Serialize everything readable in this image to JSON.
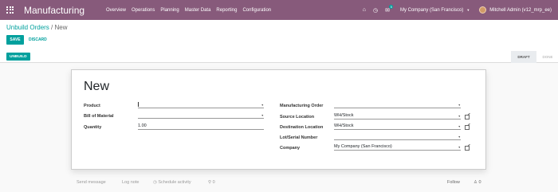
{
  "navbar": {
    "app_title": "Manufacturing",
    "menu": [
      "Overview",
      "Operations",
      "Planning",
      "Master Data",
      "Reporting",
      "Configuration"
    ],
    "chat_count": "5",
    "company": "My Company (San Francisco)",
    "user": "Mitchell Admin (v12_mrp_ee)"
  },
  "breadcrumb": {
    "parent": "Unbuild Orders",
    "sep": "/",
    "current": "New"
  },
  "buttons": {
    "save": "SAVE",
    "discard": "DISCARD",
    "unbuild": "UNBUILD"
  },
  "status": {
    "draft": "DRAFT",
    "done": "DONE",
    "active": "draft"
  },
  "form": {
    "title": "New",
    "left": [
      {
        "label": "Product",
        "value": ""
      },
      {
        "label": "Bill of Material",
        "value": ""
      },
      {
        "label": "Quantity",
        "value": "1.00"
      }
    ],
    "right": [
      {
        "label": "Manufacturing Order",
        "value": ""
      },
      {
        "label": "Source Location",
        "value": "WH/Stock"
      },
      {
        "label": "Destination Location",
        "value": "WH/Stock"
      },
      {
        "label": "Lot/Serial Number",
        "value": ""
      },
      {
        "label": "Company",
        "value": "My Company (San Francisco)"
      }
    ]
  },
  "chatter": {
    "send_message": "Send message",
    "log_note": "Log note",
    "schedule_activity": "Schedule activity",
    "attachments": "0",
    "follow": "Follow",
    "followers": "0"
  },
  "colors": {
    "brand": "#875a7b",
    "primary": "#00a09d"
  }
}
